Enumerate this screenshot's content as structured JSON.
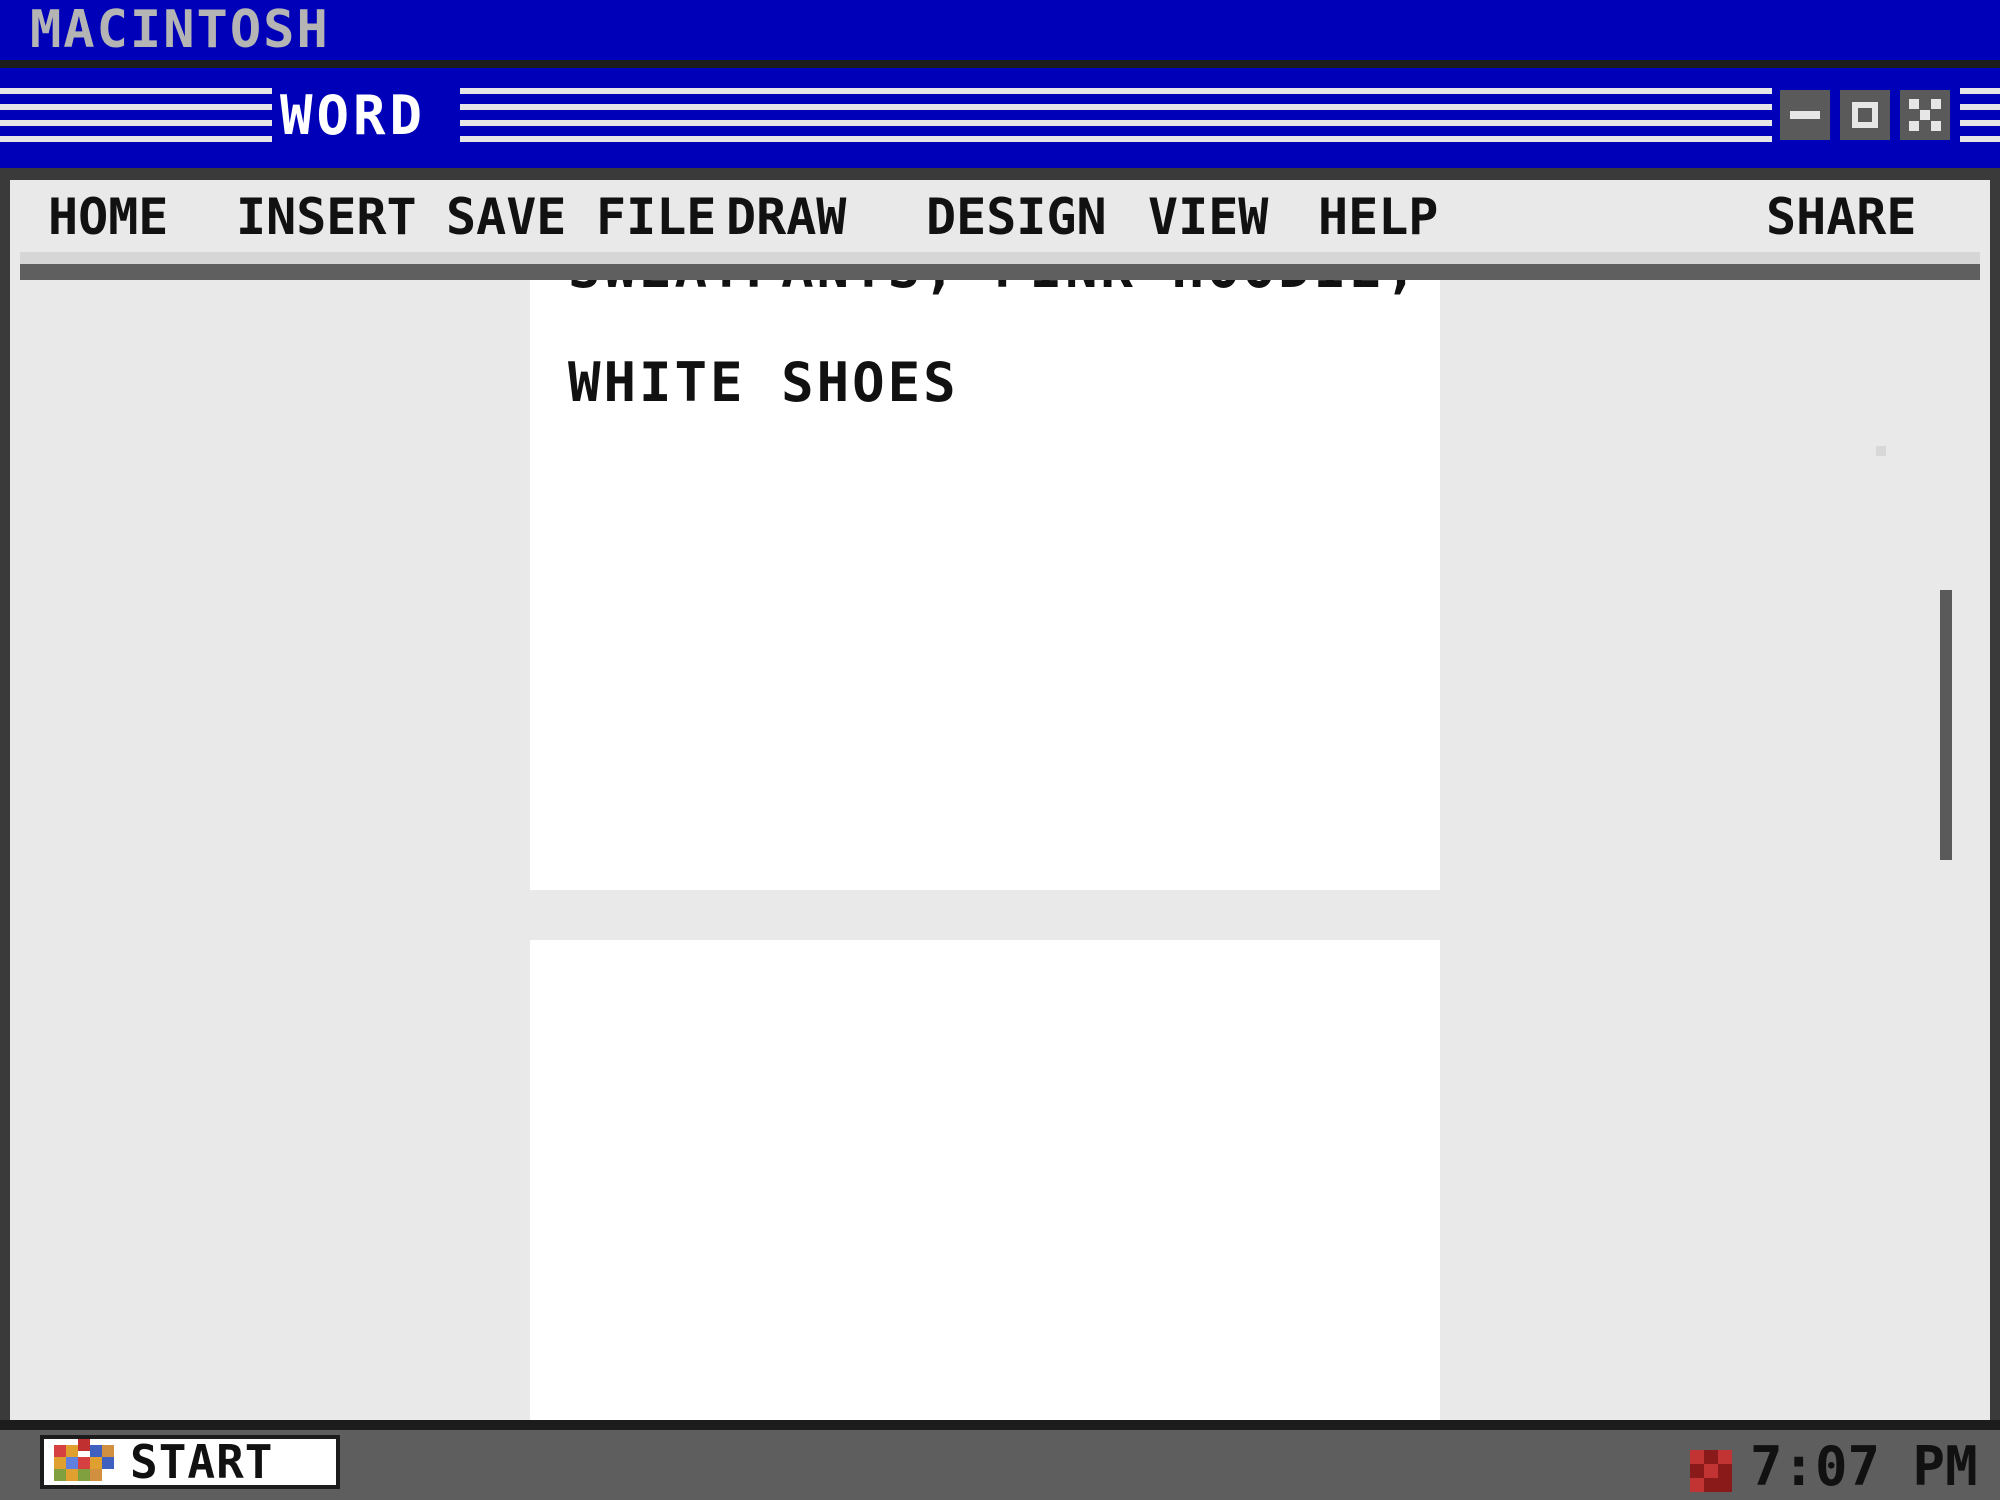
{
  "os": {
    "title": "MACINTOSH"
  },
  "window": {
    "title": "WORD",
    "controls": {
      "minimize_icon": "minimize-icon",
      "maximize_icon": "maximize-icon",
      "close_icon": "close-icon"
    }
  },
  "menubar": {
    "items": [
      "HOME",
      "INSERT",
      "SAVE",
      "FILE",
      "DRAW",
      "DESIGN",
      "VIEW",
      "HELP"
    ],
    "share_label": "SHARE"
  },
  "document": {
    "lines": [
      "SWEATPANTS, PINK HOODIE,",
      "WHITE SHOES"
    ]
  },
  "taskbar": {
    "start_label": "START",
    "clock": "7:07 PM"
  },
  "colors": {
    "title_bar": "#0000b8",
    "window_bg": "#e9e9e9",
    "page_bg": "#ffffff",
    "taskbar": "#5e5e5e",
    "text": "#111111"
  }
}
